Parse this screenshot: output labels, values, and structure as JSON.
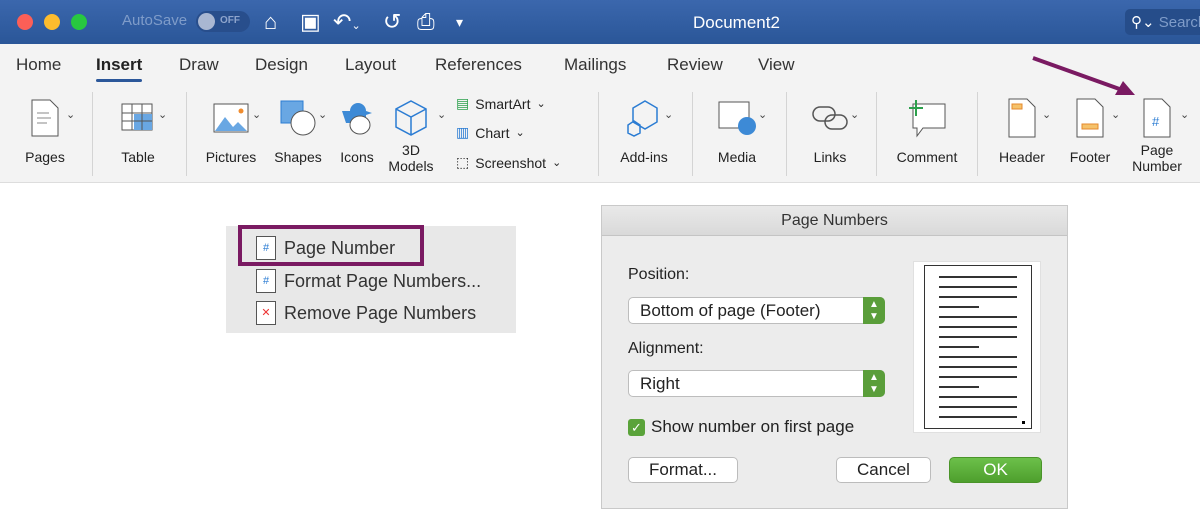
{
  "titlebar": {
    "autosave_label": "AutoSave",
    "autosave_state": "OFF",
    "document_title": "Document2",
    "search_placeholder": "Search"
  },
  "tabs": [
    "Home",
    "Insert",
    "Draw",
    "Design",
    "Layout",
    "References",
    "Mailings",
    "Review",
    "View"
  ],
  "active_tab": "Insert",
  "ribbon": {
    "pages": "Pages",
    "table": "Table",
    "pictures": "Pictures",
    "shapes": "Shapes",
    "icons": "Icons",
    "models_1": "3D",
    "models_2": "Models",
    "smartart": "SmartArt",
    "chart": "Chart",
    "screenshot": "Screenshot",
    "addins": "Add-ins",
    "media": "Media",
    "links": "Links",
    "comment": "Comment",
    "header": "Header",
    "footer": "Footer",
    "page_number_1": "Page",
    "page_number_2": "Number"
  },
  "menu": {
    "items": [
      "Page Number",
      "Format Page Numbers...",
      "Remove Page Numbers"
    ]
  },
  "dialog": {
    "title": "Page Numbers",
    "position_label": "Position:",
    "position_value": "Bottom of page (Footer)",
    "alignment_label": "Alignment:",
    "alignment_value": "Right",
    "show_first_page_label": "Show number on first page",
    "show_first_page_checked": true,
    "format_button": "Format...",
    "cancel_button": "Cancel",
    "ok_button": "OK"
  },
  "colors": {
    "titlebar": "#2b579a",
    "highlight": "#7a1a62",
    "ok": "#5aa33a"
  }
}
